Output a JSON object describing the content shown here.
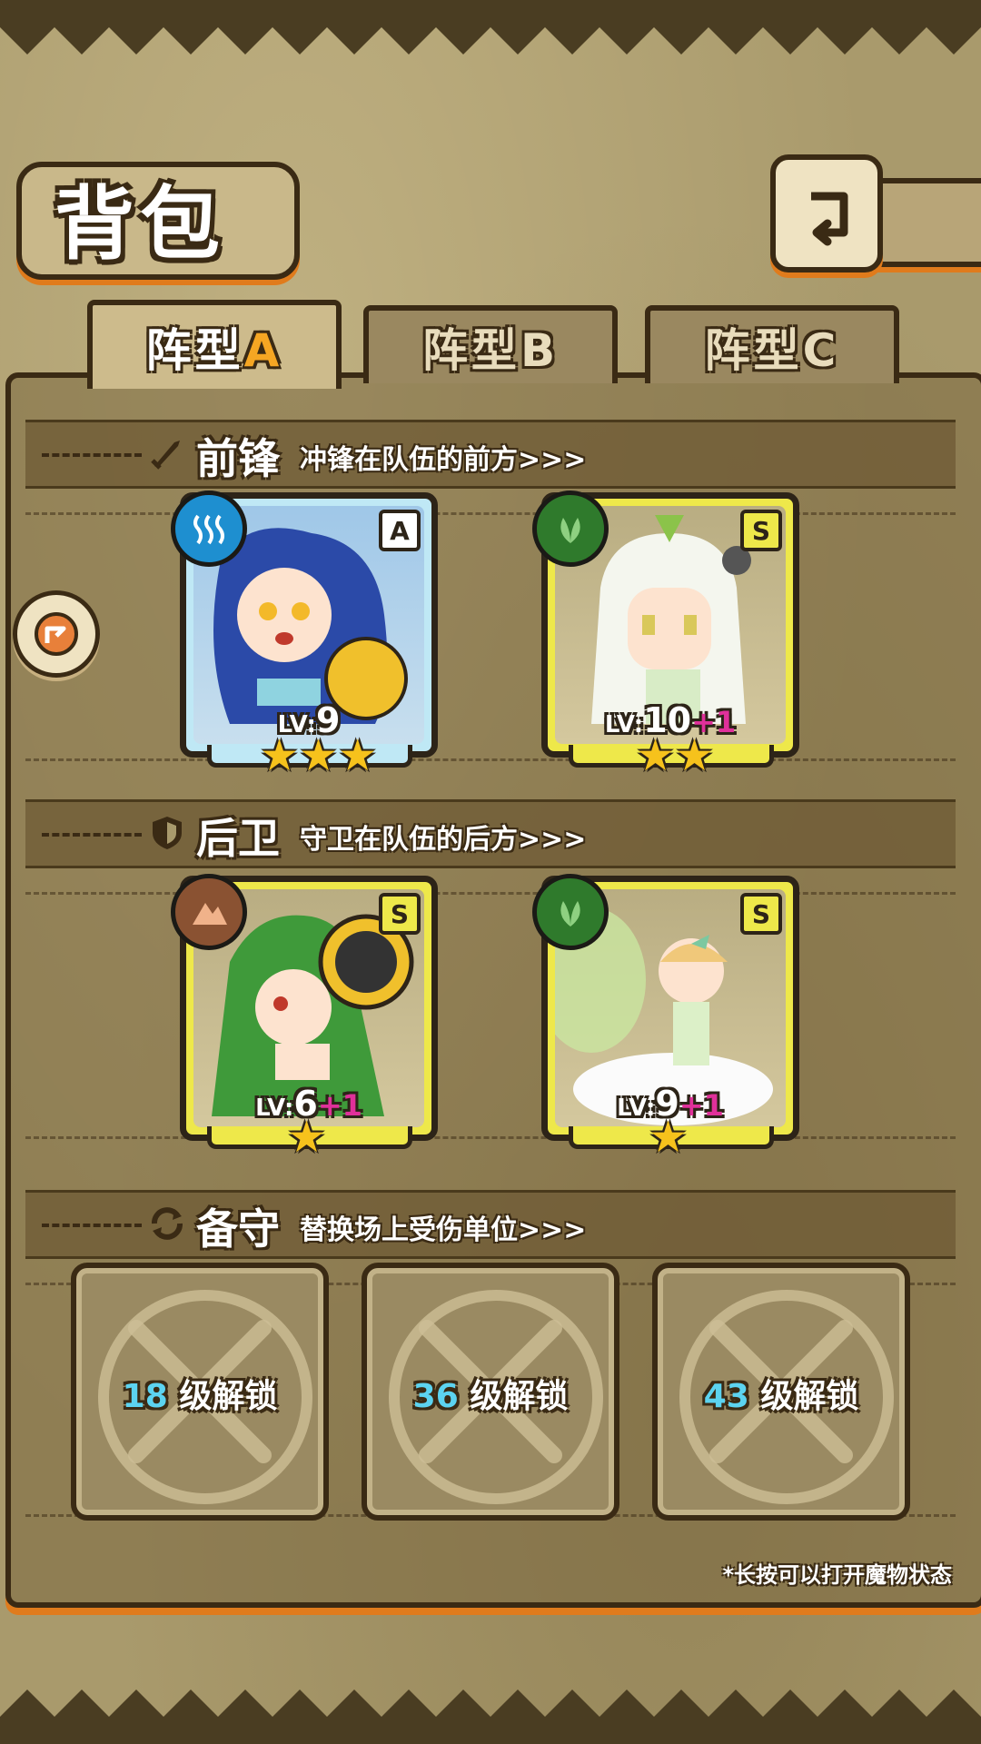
{
  "title": "背包",
  "tabs": [
    {
      "label_prefix": "阵型",
      "label_letter": "A",
      "active": true
    },
    {
      "label_prefix": "阵型",
      "label_letter": "B",
      "active": false
    },
    {
      "label_prefix": "阵型",
      "label_letter": "C",
      "active": false
    }
  ],
  "sections": {
    "front": {
      "title": "前锋",
      "desc": "冲锋在队伍的前方>>>",
      "icon": "sword-icon"
    },
    "back": {
      "title": "后卫",
      "desc": "守卫在队伍的后方>>>",
      "icon": "shield-icon"
    },
    "reserve": {
      "title": "备守",
      "desc": "替换场上受伤单位>>>",
      "icon": "swap-icon"
    }
  },
  "units": [
    {
      "slot": "front-1",
      "rank": "A",
      "element": "water-icon",
      "level_prefix": "LV:",
      "level": "9",
      "bonus": "",
      "stars": 3
    },
    {
      "slot": "front-2",
      "rank": "S",
      "element": "leaf-icon",
      "level_prefix": "LV:",
      "level": "10",
      "bonus": "+1",
      "stars": 2
    },
    {
      "slot": "back-1",
      "rank": "S",
      "element": "earth-icon",
      "level_prefix": "LV:",
      "level": "6",
      "bonus": "+1",
      "stars": 1
    },
    {
      "slot": "back-2",
      "rank": "S",
      "element": "leaf-icon",
      "level_prefix": "LV:",
      "level": "9",
      "bonus": "+1",
      "stars": 1
    }
  ],
  "locked_slots": [
    {
      "level": "18",
      "label": "级解锁"
    },
    {
      "level": "36",
      "label": "级解锁"
    },
    {
      "level": "43",
      "label": "级解锁"
    }
  ],
  "tip": "*长按可以打开魔物状态",
  "colors": {
    "accent": "#e07b1c",
    "outline": "#3a2a14",
    "rank_s": "#eee84a",
    "rank_a": "#bfe8f5",
    "bonus": "#e0309a",
    "lock_num": "#5cd3f0"
  }
}
